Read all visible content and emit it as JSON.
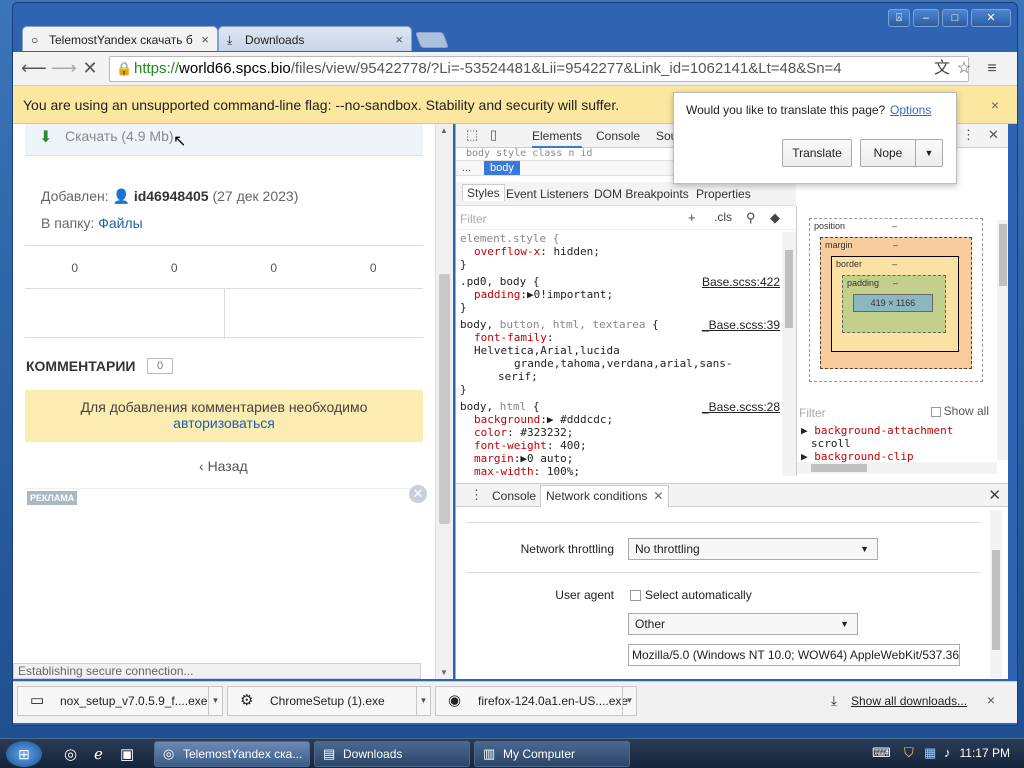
{
  "window": {
    "controls": {
      "user": "⍓",
      "minimize": "–",
      "maximize": "□",
      "close": "✕"
    }
  },
  "tabs": [
    {
      "label": "TelemostYandex скачать б",
      "icon": "○",
      "close": "×"
    },
    {
      "label": "Downloads",
      "icon": "⤓",
      "close": "×"
    }
  ],
  "toolbar": {
    "back": "⟵",
    "forward": "⟶",
    "stop": "✕",
    "url_scheme": "https://",
    "url_host": "world66.spcs.bio",
    "url_rest": "/files/view/95422778/?Li=-53524481&Lii=9542277&Link_id=1062141&Lt=48&Sn=4",
    "translate_icon": "文",
    "bookmark_icon": "☆",
    "menu_icon": "≡"
  },
  "infobar": {
    "text": "You are using an unsupported command-line flag: --no-sandbox. Stability and security will suffer.",
    "close": "×"
  },
  "translate_bubble": {
    "question": "Would you like to translate this page?",
    "options_link": "Options",
    "translate_button": "Translate",
    "nope_button": "Nope",
    "dropdown": "▼"
  },
  "page": {
    "download_label": "Скачать (4.9 Mb)",
    "added_label": "Добавлен:",
    "user_id": "id46948405",
    "added_date": "(27 дек 2023)",
    "folder_label": "В папку:",
    "folder_link": "Файлы",
    "stats": [
      "0",
      "0",
      "0",
      "0"
    ],
    "comments_title": "КОММЕНТАРИИ",
    "comments_count": "0",
    "notice_line1": "Для добавления комментариев необходимо",
    "notice_link": "авторизоваться",
    "back_link": "Назад",
    "ad_label": "РЕКЛАМА",
    "status": "Establishing secure connection..."
  },
  "devtools": {
    "tabs": [
      "Elements",
      "Console",
      "Sou"
    ],
    "dom_peek": "  body  style  class  n  id  ",
    "breadcrumb_dots": "...",
    "breadcrumb_active": "body",
    "subtabs": [
      "Styles",
      "Event Listeners",
      "DOM Breakpoints",
      "Properties"
    ],
    "filter_placeholder": "Filter",
    "cls_label": ".cls",
    "rules": {
      "r1_sel": "element.style {",
      "r1_p1_name": "overflow-x",
      "r1_p1_val": ": hidden;",
      "r2_sel": ".pd0, body {",
      "r2_src": "Base.scss:422",
      "r2_p1_name": "padding",
      "r2_p1_val": ":▶0!important;",
      "r3_sel_a": "body, ",
      "r3_sel_b": "button, html, textarea",
      "r3_sel_c": " {",
      "r3_src": "_Base.scss:39",
      "r3_p1_name": "font-family",
      "r3_p1_val": ": Helvetica,Arial,lucida",
      "r3_p1_val2": "grande,tahoma,verdana,arial,sans-",
      "r3_p1_val3": "serif;",
      "r4_sel_a": "body, ",
      "r4_sel_b": "html",
      "r4_sel_c": " {",
      "r4_src": "_Base.scss:28",
      "r4_p1_name": "background",
      "r4_p1_val": ":▶ #dddcdc;",
      "r4_p2_name": "color",
      "r4_p2_val": ": #323232;",
      "r4_p3_name": "font-weight",
      "r4_p3_val": ": 400;",
      "r4_p4_name": "margin",
      "r4_p4_val": ":▶0 auto;",
      "r4_p5_name": "max-width",
      "r4_p5_val": ": 100%;",
      "close_brace": "}"
    },
    "boxmodel": {
      "position": "position",
      "margin": "margin",
      "border": "border",
      "padding": "padding",
      "content": "419 × 1166",
      "dash": "–"
    },
    "sidebar_filter": "Filter",
    "show_all": "Show all",
    "computed_props": [
      "background-attachment",
      "scroll",
      "background-clip"
    ],
    "drawer_tabs": [
      "Console",
      "Network conditions"
    ],
    "network_throttling_label": "Network throttling",
    "network_throttling_value": "No throttling",
    "user_agent_label": "User agent",
    "select_automatically": "Select automatically",
    "ua_select_value": "Other",
    "ua_string": "Mozilla/5.0 (Windows NT 10.0; WOW64) AppleWebKit/537.36 (",
    "colors": {
      "accent": "#3879d9",
      "swatch_bg": "#dddcdc",
      "swatch_color": "#323232"
    }
  },
  "downloads": {
    "items": [
      "nox_setup_v7.0.5.9_f....exe",
      "ChromeSetup (1).exe",
      "firefox-124.0a1.en-US....exe"
    ],
    "show_all": "Show all downloads...",
    "close": "×"
  },
  "taskbar": {
    "tasks": [
      "TelemostYandex ска...",
      "Downloads",
      "My Computer"
    ],
    "time": "11:17 PM"
  }
}
